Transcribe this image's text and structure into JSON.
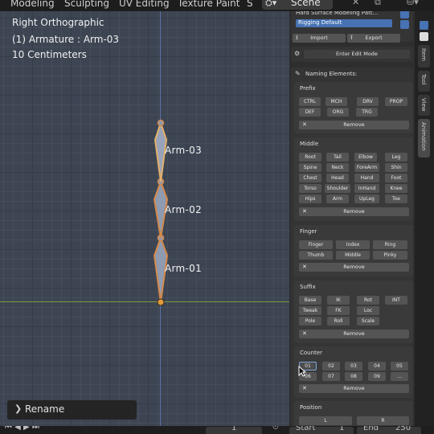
{
  "topbar": {
    "tabs": [
      "Modeling",
      "Sculpting",
      "UV Editing",
      "Texture Paint",
      "S"
    ],
    "scene_label": "Scene",
    "scene_icon": "scene-icon"
  },
  "viewport": {
    "view_name": "Right Orthographic",
    "object_info": "(1) Armature : Arm-03",
    "scale_info": "10 Centimeters",
    "bone_labels": [
      "Arm-03",
      "Arm-02",
      "Arm-01"
    ],
    "colors": {
      "background": "#3d4553",
      "bone_fill": "#8e9ab0",
      "bone_outline": "#d4894a",
      "bone_active": "#e3b06b",
      "x_axis": "#7f9a43",
      "z_axis": "#5b72a6"
    },
    "rename_panel": {
      "label": "Rename",
      "icon": "chevron-right-icon"
    }
  },
  "sidebar": {
    "list_items": [
      "Hard Surface Modeling Patt...",
      "Rigging Default"
    ],
    "selected_item": "Rigging Default",
    "import_label": "Import",
    "export_label": "Export",
    "enter_edit_label": "Enter Edit Mode",
    "naming_title": "Naming Elements:",
    "sections": {
      "prefix": {
        "title": "Prefix",
        "buttons": [
          "CTRL",
          "MCH",
          "DRV",
          "PROP",
          "DEF",
          "ORG",
          "TRG"
        ],
        "remove": "Remove"
      },
      "middle": {
        "title": "Middle",
        "buttons": [
          "Root",
          "Tail",
          "Elbow",
          "Leg",
          "Spine",
          "Neck",
          "ForeArm",
          "Shin",
          "Chest",
          "Head",
          "Hand",
          "Foot",
          "Torso",
          "Shoulder",
          "InHand",
          "Knee",
          "Hips",
          "Arm",
          "UpLeg",
          "Toe"
        ],
        "remove": "Remove"
      },
      "finger": {
        "title": "Finger",
        "buttons": [
          "Finger",
          "Index",
          "Ring",
          "Thumb",
          "Middle",
          "Pinky"
        ],
        "remove": "Remove"
      },
      "suffix": {
        "title": "Suffix",
        "buttons": [
          "Base",
          "IK",
          "Rot",
          "INT",
          "Tweak",
          "FK",
          "Loc",
          "Pole",
          "Roll",
          "Scale"
        ],
        "remove": "Remove"
      },
      "counter": {
        "title": "Counter",
        "buttons": [
          "01",
          "02",
          "03",
          "04",
          "05",
          "06",
          "07",
          "08",
          "09",
          "..."
        ],
        "remove": "Remove"
      },
      "position": {
        "title": "Position",
        "buttons": [
          "L",
          "R"
        ]
      }
    },
    "vtabs": [
      "Item",
      "Tool",
      "View",
      "Animation"
    ],
    "accent": "#4772b3"
  },
  "bottombar": {
    "start_label": "Start",
    "start_value": "1",
    "end_label": "End",
    "end_value": "250",
    "frame_value": "1"
  }
}
